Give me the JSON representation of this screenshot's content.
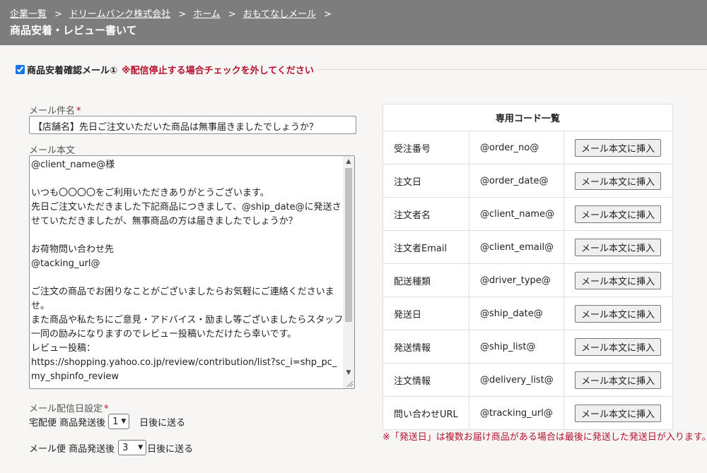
{
  "breadcrumb": {
    "items": [
      "企業一覧",
      "ドリームバンク株式会社",
      "ホーム",
      "おもてなしメール"
    ],
    "separator": ">"
  },
  "page": {
    "title": "商品安着・レビュー書いて"
  },
  "mail": {
    "enabled": true,
    "label": "商品安着確認メール①",
    "warning": "※配信停止する場合チェックを外してください"
  },
  "form": {
    "required_mark": "*",
    "subject_label": "メール件名",
    "subject_value": "【店舗名】先日ご注文いただいた商品は無事届きましたでしょうか？",
    "body_label": "メール本文",
    "body_value": "@client_name@様\n\nいつも〇〇〇〇をご利用いただきありがとうございます。\n先日ご注文いただきました下記商品につきまして、@ship_date@に発送させていただきましたが、無事商品の方は届きましたでしょうか？\n\nお荷物問い合わせ先\n@tacking_url@\n\nご注文の商品でお困りなことがございましたらお気軽にご連絡くださいませ。\nまた商品や私たちにご意見・アドバイス・励まし等ございましたらスタッフ一同の励みになりますのでレビュー投稿いただけたら幸いです。\nレビュー投稿：\nhttps://shopping.yahoo.co.jp/review/contribution/list?sc_i=shp_pc_my_shpinfo_review",
    "delivery_label": "メール配信日設定",
    "takuhai": {
      "prefix": "宅配便 商品発送後",
      "value": "1",
      "suffix": "日後に送る"
    },
    "mailbin": {
      "prefix": "メール便 商品発送後",
      "value": "3",
      "suffix": "日後に送る"
    }
  },
  "codes": {
    "header": "専用コード一覧",
    "button_label": "メール本文に挿入",
    "rows": [
      {
        "name": "受注番号",
        "code": "@order_no@"
      },
      {
        "name": "注文日",
        "code": "@order_date@"
      },
      {
        "name": "注文者名",
        "code": "@client_name@"
      },
      {
        "name": "注文者Email",
        "code": "@client_email@"
      },
      {
        "name": "配送種類",
        "code": "@driver_type@"
      },
      {
        "name": "発送日",
        "code": "@ship_date@"
      },
      {
        "name": "発送情報",
        "code": "@ship_list@"
      },
      {
        "name": "注文情報",
        "code": "@delivery_list@"
      },
      {
        "name": "問い合わせURL",
        "code": "@tracking_url@"
      }
    ],
    "note": "※「発送日」は複数お届け商品がある場合は最後に発送した発送日が入ります。"
  },
  "colors": {
    "header_bg": "#7d7d7d",
    "warning": "#b3122e",
    "page_bg": "#f7f6f5"
  },
  "icons": {
    "checkbox": "checkbox-checked",
    "select": "chevron-down-icon"
  }
}
